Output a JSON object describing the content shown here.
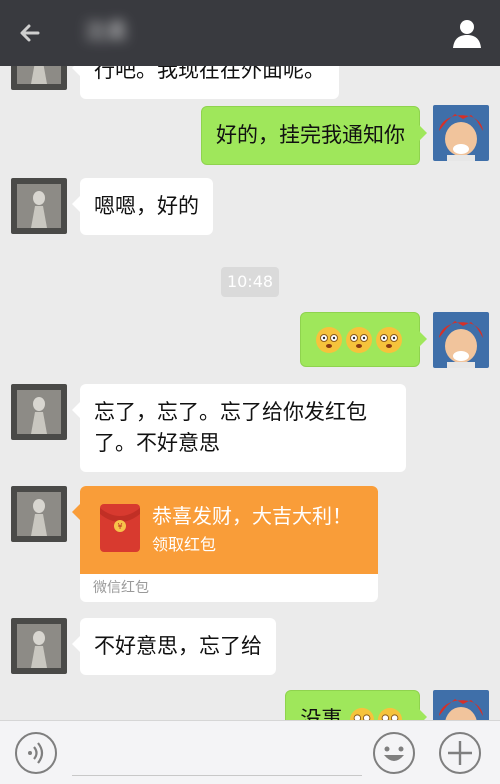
{
  "header": {
    "title": "沈柔",
    "back_icon": "back-arrow-icon",
    "profile_icon": "person-icon",
    "background": "#393a3f"
  },
  "messages": [
    {
      "side": "left",
      "text": "行吧。我现在在外面呢。"
    },
    {
      "side": "right",
      "text": "好的，挂完我通知你"
    },
    {
      "side": "left",
      "text": "嗯嗯，好的"
    },
    {
      "side": "right",
      "emojis": [
        "awkward-face-icon",
        "awkward-face-icon",
        "awkward-face-icon"
      ]
    },
    {
      "side": "left",
      "line1": "忘了，忘了。忘了给你发红包",
      "line2": "了。不好意思"
    },
    {
      "side": "left",
      "text": "不好意思，忘了给"
    },
    {
      "side": "right",
      "text": "没事"
    }
  ],
  "timestamp": "10:48",
  "red_packet": {
    "title": "恭喜发财，大吉大利！",
    "action": "领取红包",
    "footer": "微信红包",
    "color": "#f99d39"
  },
  "input_bar": {
    "placeholder": "",
    "voice_icon": "voice-icon",
    "emoji_icon": "emoji-icon",
    "plus_icon": "plus-icon"
  },
  "colors": {
    "self_bubble": "#9fe75b",
    "other_bubble": "#ffffff",
    "chat_background": "#ebebeb"
  }
}
